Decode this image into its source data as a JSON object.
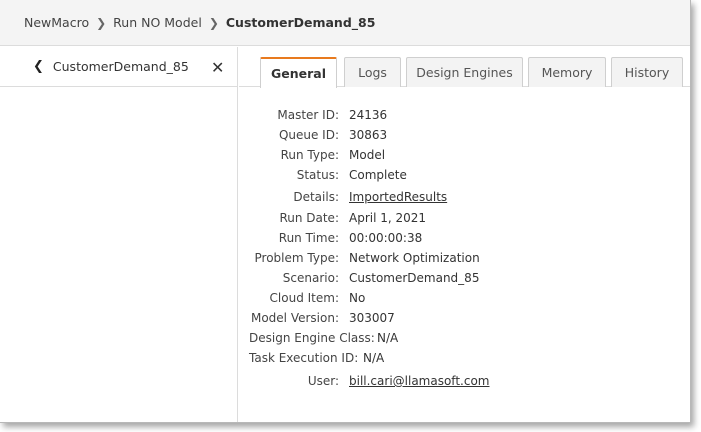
{
  "breadcrumb": {
    "items": [
      "NewMacro",
      "Run NO Model",
      "CustomerDemand_85"
    ]
  },
  "sidebar": {
    "title": "CustomerDemand_85"
  },
  "tabs": [
    {
      "label": "General",
      "active": true
    },
    {
      "label": "Logs",
      "active": false
    },
    {
      "label": "Design Engines",
      "active": false
    },
    {
      "label": "Memory",
      "active": false
    },
    {
      "label": "History",
      "active": false
    }
  ],
  "details": {
    "master_id": {
      "label": "Master ID:",
      "value": "24136"
    },
    "queue_id": {
      "label": "Queue ID:",
      "value": "30863"
    },
    "run_type": {
      "label": "Run Type:",
      "value": "Model"
    },
    "status": {
      "label": "Status:",
      "value": "Complete"
    },
    "details": {
      "label": "Details:",
      "value": "ImportedResults"
    },
    "run_date": {
      "label": "Run Date:",
      "value": "April 1, 2021"
    },
    "run_time": {
      "label": "Run Time:",
      "value": "00:00:00:38"
    },
    "problem_type": {
      "label": "Problem Type:",
      "value": "Network Optimization"
    },
    "scenario": {
      "label": "Scenario:",
      "value": "CustomerDemand_85"
    },
    "cloud_item": {
      "label": "Cloud Item:",
      "value": "No"
    },
    "model_version": {
      "label": "Model Version:",
      "value": "303007"
    },
    "design_engine_class": {
      "label": "Design Engine Class:",
      "value": "N/A"
    },
    "task_execution_id": {
      "label": "Task Execution ID:",
      "value": "N/A"
    },
    "user": {
      "label": "User:",
      "value": "bill.cari@llamasoft.com"
    }
  },
  "colors": {
    "active_tab_accent": "#e87a1e",
    "breadcrumb_bg": "#f4f4f4"
  }
}
